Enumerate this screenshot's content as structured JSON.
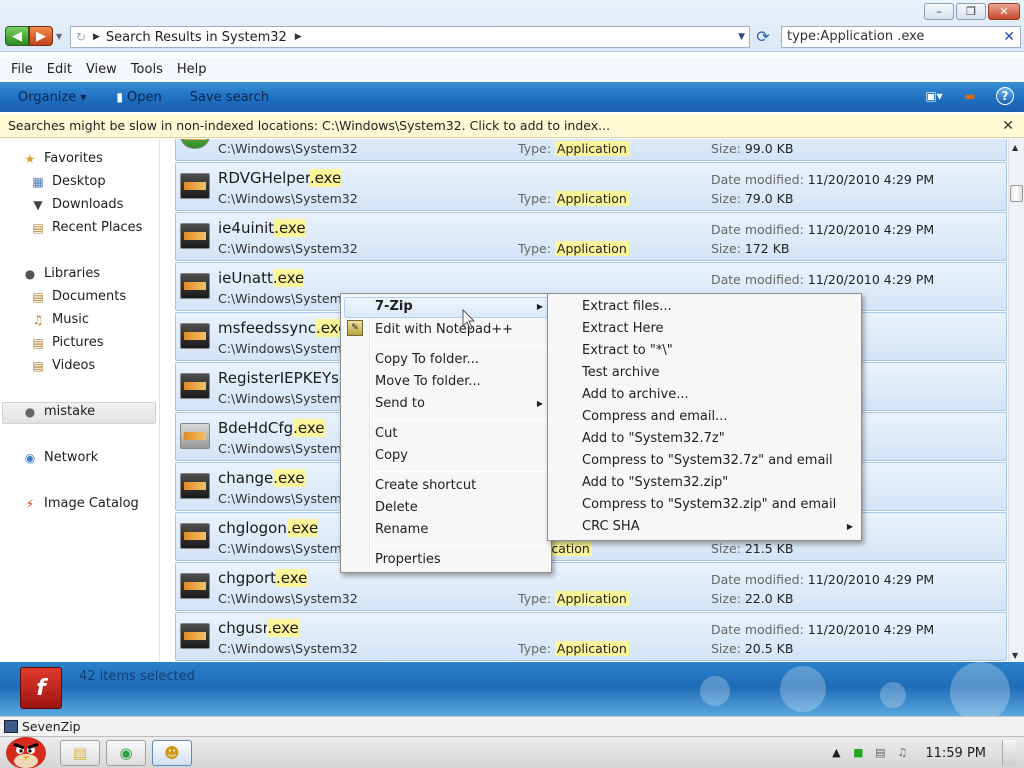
{
  "window": {
    "address_path": "Search Results in System32",
    "search_query": "type:Application .exe",
    "minimize": "–",
    "maximize": "❐",
    "close": "✕"
  },
  "menubar": [
    "File",
    "Edit",
    "View",
    "Tools",
    "Help"
  ],
  "cmdbar": {
    "organize": "Organize",
    "open": "Open",
    "save_search": "Save search"
  },
  "infobar": {
    "text": "Searches might be slow in non-indexed locations: C:\\Windows\\System32. Click to add to index..."
  },
  "navpane": {
    "favorites": "Favorites",
    "desktop": "Desktop",
    "downloads": "Downloads",
    "recent_places": "Recent Places",
    "libraries": "Libraries",
    "documents": "Documents",
    "music": "Music",
    "pictures": "Pictures",
    "videos": "Videos",
    "mistake": "mistake",
    "network": "Network",
    "image_catalog": "Image Catalog"
  },
  "file_labels": {
    "type": "Type:",
    "date_modified": "Date modified:",
    "size": "Size:"
  },
  "files": [
    {
      "base": "",
      "ext": "",
      "path": "C:\\Windows\\System32",
      "type": "Application",
      "date": "",
      "size": "99.0 KB"
    },
    {
      "base": "RDVGHelper",
      "ext": ".exe",
      "path": "C:\\Windows\\System32",
      "type": "Application",
      "date": "11/20/2010 4:29 PM",
      "size": "79.0 KB"
    },
    {
      "base": "ie4uinit",
      "ext": ".exe",
      "path": "C:\\Windows\\System32",
      "type": "Application",
      "date": "11/20/2010 4:29 PM",
      "size": "172 KB"
    },
    {
      "base": "ieUnatt",
      "ext": ".exe",
      "path": "C:\\Windows\\System32",
      "type": "",
      "date": "11/20/2010 4:29 PM",
      "size": ""
    },
    {
      "base": "msfeedssync",
      "ext": ".exe",
      "path": "C:\\Windows\\System32",
      "type": "",
      "date": "",
      "size": ""
    },
    {
      "base": "RegisterIEPKEYs",
      "ext": "",
      "path": "C:\\Windows\\System32",
      "type": "",
      "date": "",
      "size": ""
    },
    {
      "base": "BdeHdCfg",
      "ext": ".exe",
      "path": "C:\\Windows\\System32",
      "type": "",
      "date": "",
      "size": ""
    },
    {
      "base": "change",
      "ext": ".exe",
      "path": "C:\\Windows\\System32",
      "type": "",
      "date": "",
      "size": ""
    },
    {
      "base": "chglogon",
      "ext": ".exe",
      "path": "C:\\Windows\\System32",
      "type": "Application",
      "date": "",
      "size": "21.5 KB"
    },
    {
      "base": "chgport",
      "ext": ".exe",
      "path": "C:\\Windows\\System32",
      "type": "Application",
      "date": "11/20/2010 4:29 PM",
      "size": "22.0 KB"
    },
    {
      "base": "chgusr",
      "ext": ".exe",
      "path": "C:\\Windows\\System32",
      "type": "Application",
      "date": "11/20/2010 4:29 PM",
      "size": "20.5 KB"
    }
  ],
  "context_menu": {
    "seven_zip": "7-Zip",
    "edit_notepad": "Edit with Notepad++",
    "copy_to_folder": "Copy To folder...",
    "move_to_folder": "Move To folder...",
    "send_to": "Send to",
    "cut": "Cut",
    "copy": "Copy",
    "create_shortcut": "Create shortcut",
    "delete": "Delete",
    "rename": "Rename",
    "properties": "Properties"
  },
  "sevenzip_submenu": [
    "Extract files...",
    "Extract Here",
    "Extract to \"*\\\"",
    "Test archive",
    "Add to archive...",
    "Compress and email...",
    "Add to \"System32.7z\"",
    "Compress to \"System32.7z\" and email",
    "Add to \"System32.zip\"",
    "Compress to \"System32.zip\" and email",
    "CRC SHA"
  ],
  "details": {
    "selection": "42 items selected"
  },
  "taskbar": {
    "tooltip_app": "SevenZip",
    "clock": "11:59 PM"
  },
  "colors": {
    "highlight": "#fbf59a",
    "row_bg": "#d3e4f7",
    "command_bar": "#1e6fc0"
  }
}
